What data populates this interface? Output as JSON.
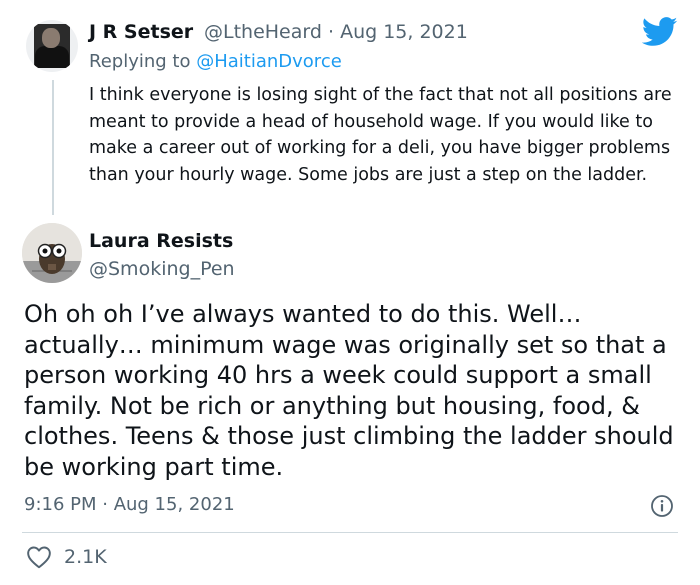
{
  "reply_tweet": {
    "author_name": "J R Setser",
    "author_handle": "@LtheHeard",
    "separator": "·",
    "date": "Aug 15, 2021",
    "replying_prefix": "Replying to",
    "replying_to": "@HaitianDvorce",
    "text": "I think everyone is losing sight of the fact that not all positions are meant to provide a head of household wage. If you would like to make a career out of working for a deli, you have bigger problems than your hourly wage. Some jobs are just a step on the ladder."
  },
  "main_tweet": {
    "author_name": "Laura Resists",
    "author_handle": "@Smoking_Pen",
    "text": "Oh oh oh I’ve always wanted to do this. Well… actually… minimum wage was originally set so that a person working 40 hrs a week could support a small family. Not be rich or anything but housing, food, & clothes. Teens & those just climbing the ladder should be working part time.",
    "timestamp": "9:16 PM · Aug 15, 2021",
    "like_count": "2.1K"
  },
  "icons": {
    "brand": "twitter-bird-icon",
    "info": "info-icon",
    "like": "heart-icon"
  },
  "colors": {
    "brand_blue": "#1d9bf0",
    "text_primary": "#0f1419",
    "text_secondary": "#536471",
    "divider": "#cfd9de"
  }
}
